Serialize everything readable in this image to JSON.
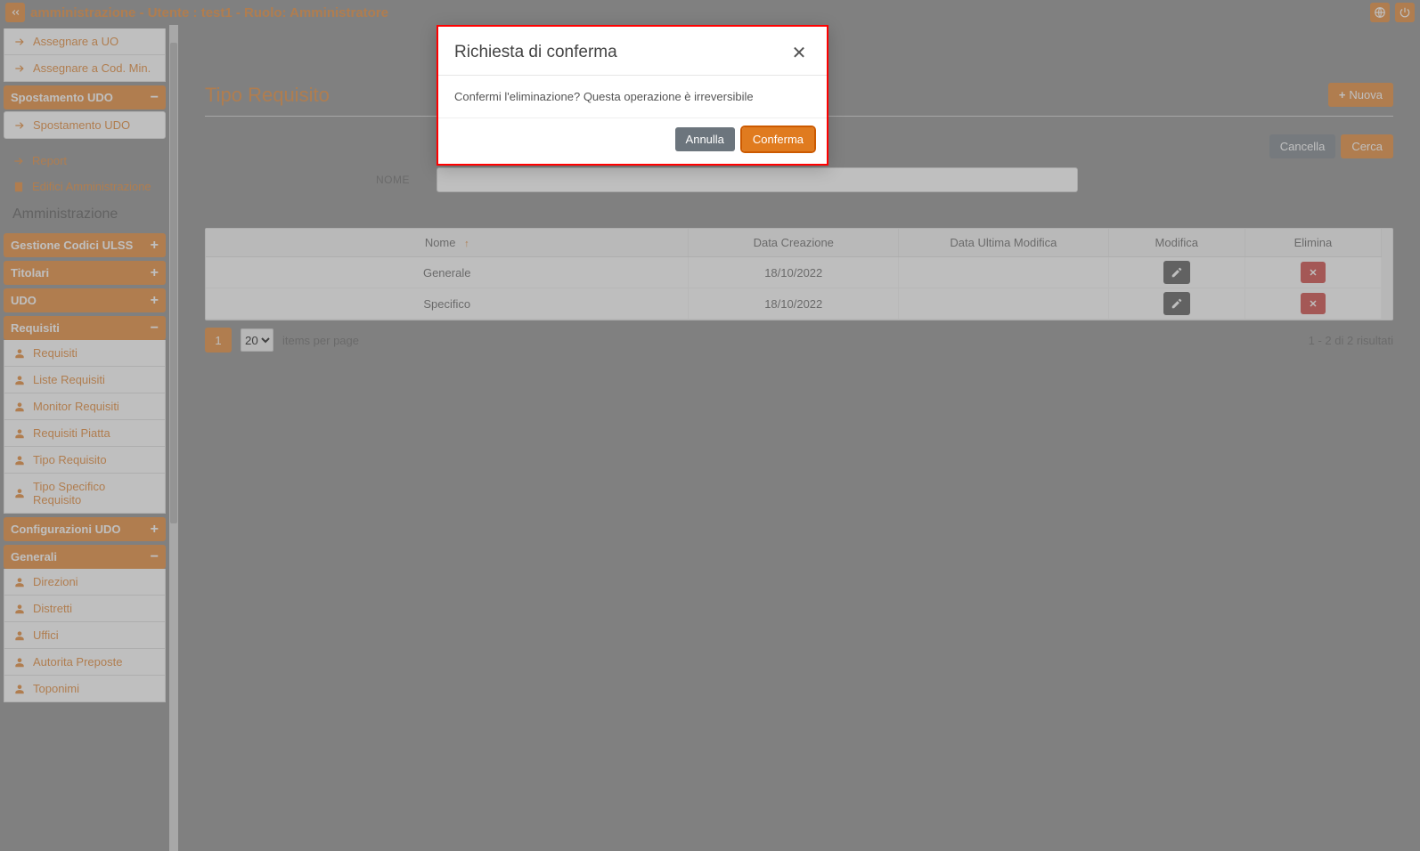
{
  "topbar": {
    "title": "amministrazione - Utente : test1 - Ruolo: Amministratore"
  },
  "sidebar": {
    "top_items": [
      "Assegnare a UO",
      "Assegnare a Cod. Min."
    ],
    "grp_spostamento": {
      "label": "Spostamento UDO",
      "item": "Spostamento UDO"
    },
    "loose": {
      "report": "Report",
      "edifici": "Edifici Amministrazione",
      "adm": "Amministrazione"
    },
    "grp_codici": {
      "label": "Gestione Codici ULSS"
    },
    "grp_titolari": {
      "label": "Titolari"
    },
    "grp_udo": {
      "label": "UDO"
    },
    "grp_requisiti": {
      "label": "Requisiti",
      "items": [
        "Requisiti",
        "Liste Requisiti",
        "Monitor Requisiti",
        "Requisiti Piatta",
        "Tipo Requisito",
        "Tipo Specifico Requisito"
      ]
    },
    "grp_conf": {
      "label": "Configurazioni UDO"
    },
    "grp_generali": {
      "label": "Generali",
      "items": [
        "Direzioni",
        "Distretti",
        "Uffici",
        "Autorita Preposte",
        "Toponimi"
      ]
    }
  },
  "page": {
    "title": "Tipo Requisito",
    "btn_new": "Nuova",
    "btn_cancel": "Cancella",
    "btn_search": "Cerca",
    "filter_label": "NOME",
    "cols": {
      "nome": "Nome",
      "creaz": "Data Creazione",
      "mod": "Data Ultima Modifica",
      "edit": "Modifica",
      "del": "Elimina"
    },
    "rows": [
      {
        "nome": "Generale",
        "creaz": "18/10/2022",
        "mod": ""
      },
      {
        "nome": "Specifico",
        "creaz": "18/10/2022",
        "mod": ""
      }
    ],
    "pager": {
      "page": "1",
      "size": "20",
      "ipp": "items per page",
      "info": "1 - 2 di 2 risultati"
    }
  },
  "modal": {
    "title": "Richiesta di conferma",
    "body": "Confermi l'eliminazione? Questa operazione è irreversibile",
    "cancel": "Annulla",
    "confirm": "Conferma"
  }
}
